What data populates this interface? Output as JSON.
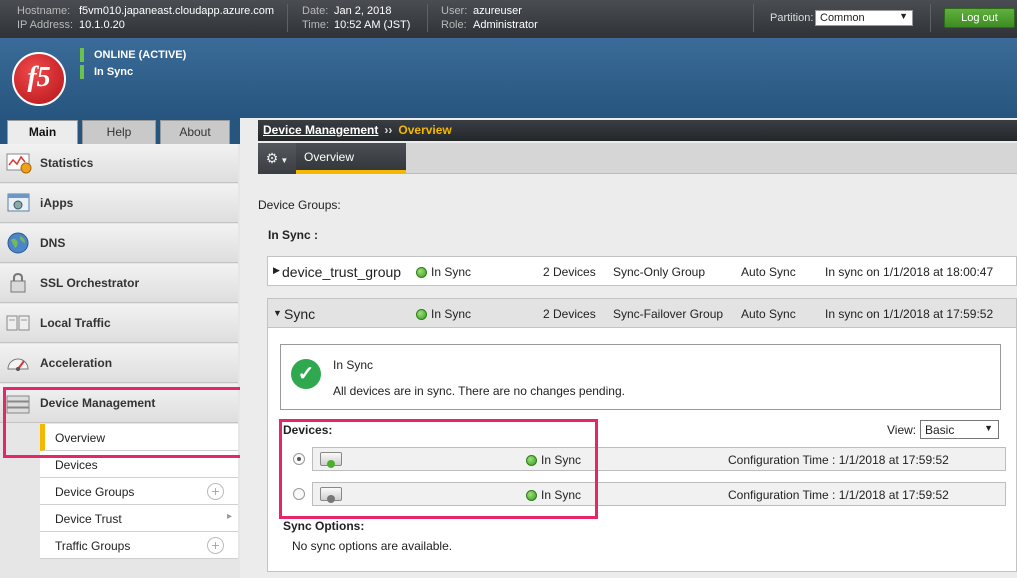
{
  "topbar": {
    "hostname_label": "Hostname:",
    "hostname": "f5vm010.japaneast.cloudapp.azure.com",
    "ip_label": "IP Address:",
    "ip": "10.1.0.20",
    "date_label": "Date:",
    "date": "Jan 2, 2018",
    "time_label": "Time:",
    "time": "10:52 AM (JST)",
    "user_label": "User:",
    "user": "azureuser",
    "role_label": "Role:",
    "role": "Administrator",
    "partition_label": "Partition:",
    "partition_value": "Common",
    "logout_label": "Log out"
  },
  "banner": {
    "logo_text": "f5",
    "status_online": "ONLINE (ACTIVE)",
    "status_sync": "In Sync"
  },
  "tabs": [
    {
      "label": "Main"
    },
    {
      "label": "Help"
    },
    {
      "label": "About"
    }
  ],
  "sidebar": {
    "items": [
      {
        "label": "Statistics"
      },
      {
        "label": "iApps"
      },
      {
        "label": "DNS"
      },
      {
        "label": "SSL Orchestrator"
      },
      {
        "label": "Local Traffic"
      },
      {
        "label": "Acceleration"
      },
      {
        "label": "Device Management"
      }
    ],
    "subitems": [
      {
        "label": "Overview"
      },
      {
        "label": "Devices"
      },
      {
        "label": "Device Groups"
      },
      {
        "label": "Device Trust"
      },
      {
        "label": "Traffic Groups"
      }
    ]
  },
  "breadcrumb": {
    "parent": "Device Management",
    "separator": "››",
    "current": "Overview"
  },
  "subtab": {
    "label": "Overview"
  },
  "main": {
    "device_groups_label": "Device Groups:",
    "in_sync_label": "In Sync :",
    "groups": [
      {
        "name": "device_trust_group",
        "status": "In Sync",
        "devices": "2 Devices",
        "type": "Sync-Only Group",
        "sync_mode": "Auto Sync",
        "last_sync": "In sync on 1/1/2018 at 18:00:47"
      },
      {
        "name": "Sync",
        "status": "In Sync",
        "devices": "2 Devices",
        "type": "Sync-Failover Group",
        "sync_mode": "Auto Sync",
        "last_sync": "In sync on 1/1/2018 at 17:59:52"
      }
    ],
    "sync_summary_title": "In Sync",
    "sync_summary_text": "All devices are in sync. There are no changes pending.",
    "devices_label": "Devices:",
    "view_label": "View:",
    "view_value": "Basic",
    "devices": [
      {
        "status": "In Sync",
        "config_time": "Configuration Time : 1/1/2018 at 17:59:52"
      },
      {
        "status": "In Sync",
        "config_time": "Configuration Time : 1/1/2018 at 17:59:52"
      }
    ],
    "sync_options_label": "Sync Options:",
    "no_sync_options": "No sync options are available."
  },
  "colors": {
    "accent_yellow": "#f5b800",
    "status_green": "#3c9a1f",
    "highlight_pink": "#e6266a",
    "banner_blue": "#2f5f8c"
  }
}
